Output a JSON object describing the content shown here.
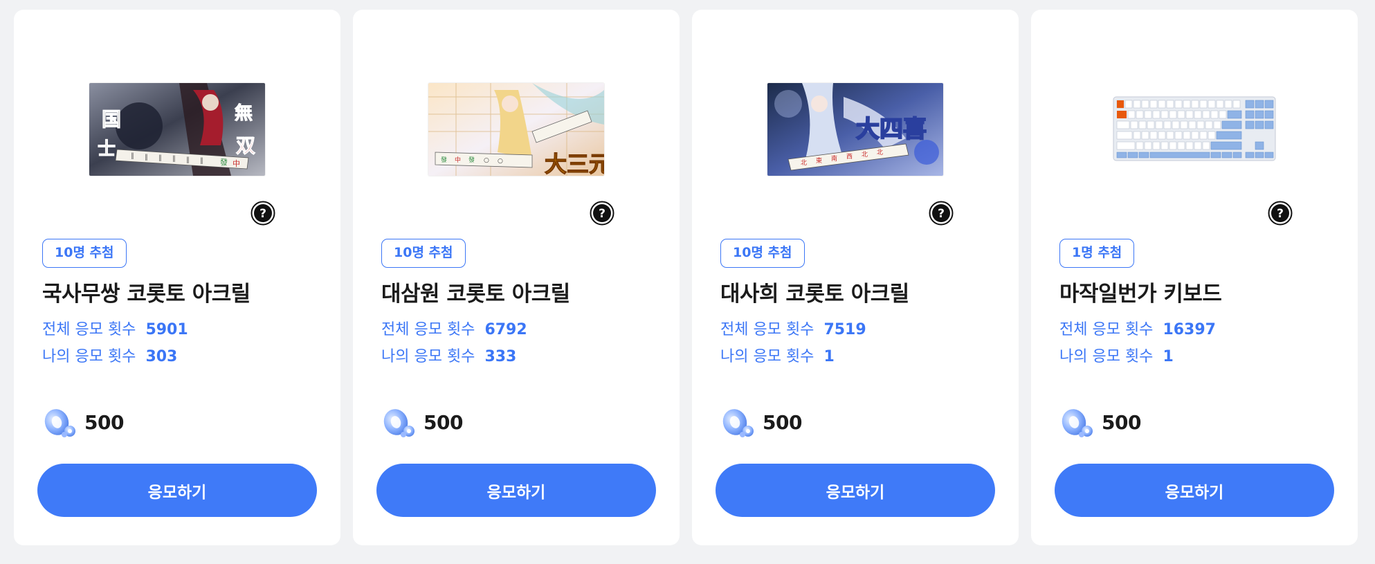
{
  "cards": [
    {
      "badge": "10명 추첨",
      "title": "국사무쌍 코롯토 아크릴",
      "total_label": "전체 응모 횟수",
      "total_value": "5901",
      "mine_label": "나의 응모 횟수",
      "mine_value": "303",
      "cost": "500",
      "button": "응모하기",
      "image": "mahjong-acrylic-art-kokushi-musou",
      "image_text": "国士無双"
    },
    {
      "badge": "10명 추첨",
      "title": "대삼원 코롯토 아크릴",
      "total_label": "전체 응모 횟수",
      "total_value": "6792",
      "mine_label": "나의 응모 횟수",
      "mine_value": "333",
      "cost": "500",
      "button": "응모하기",
      "image": "mahjong-acrylic-art-daisangen",
      "image_text": "大三元"
    },
    {
      "badge": "10명 추첨",
      "title": "대사희 코롯토 아크릴",
      "total_label": "전체 응모 횟수",
      "total_value": "7519",
      "mine_label": "나의 응모 횟수",
      "mine_value": "1",
      "cost": "500",
      "button": "응모하기",
      "image": "mahjong-acrylic-art-daisuushii",
      "image_text": "大四喜"
    },
    {
      "badge": "1명 추첨",
      "title": "마작일번가 키보드",
      "total_label": "전체 응모 횟수",
      "total_value": "16397",
      "mine_label": "나의 응모 횟수",
      "mine_value": "1",
      "cost": "500",
      "button": "응모하기",
      "image": "keyboard-product-photo"
    }
  ],
  "icons": {
    "help": "question-circle-icon",
    "currency": "blue-coin-icon"
  },
  "colors": {
    "accent": "#3f7af8",
    "text_blue": "#3b76f6",
    "background": "#f1f2f4"
  }
}
